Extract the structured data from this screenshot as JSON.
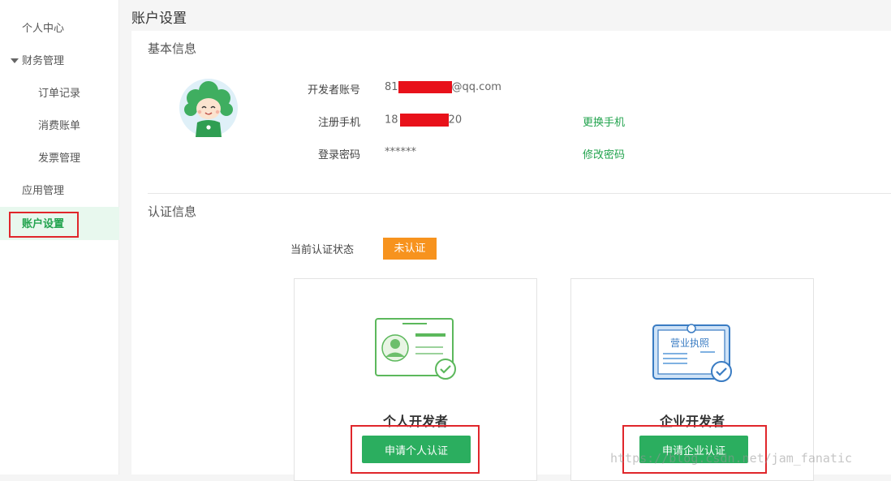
{
  "sidebar": {
    "items": [
      {
        "label": "个人中心"
      },
      {
        "label": "财务管理"
      },
      {
        "label": "订单记录"
      },
      {
        "label": "消费账单"
      },
      {
        "label": "发票管理"
      },
      {
        "label": "应用管理"
      },
      {
        "label": "账户设置"
      }
    ]
  },
  "page": {
    "title": "账户设置"
  },
  "basic_info": {
    "title": "基本信息",
    "developer_account": {
      "label": "开发者账号",
      "prefix": "81",
      "suffix": "@qq.com"
    },
    "phone": {
      "label": "注册手机",
      "prefix": "18",
      "suffix": "20",
      "action": "更换手机"
    },
    "password": {
      "label": "登录密码",
      "value": "******",
      "action": "修改密码"
    }
  },
  "certification": {
    "title": "认证信息",
    "status_label": "当前认证状态",
    "status_value": "未认证",
    "status_color": "#f7931e",
    "personal": {
      "title": "个人开发者",
      "button": "申请个人认证",
      "icon": "id-card-icon"
    },
    "enterprise": {
      "title": "企业开发者",
      "button": "申请企业认证",
      "license_text": "营业执照",
      "icon": "business-license-icon"
    }
  },
  "watermark": "https://blog.csdn.net/jam_fanatic",
  "colors": {
    "accent": "#2bae5f",
    "highlight": "#e0262b",
    "redaction": "#e8111a"
  }
}
